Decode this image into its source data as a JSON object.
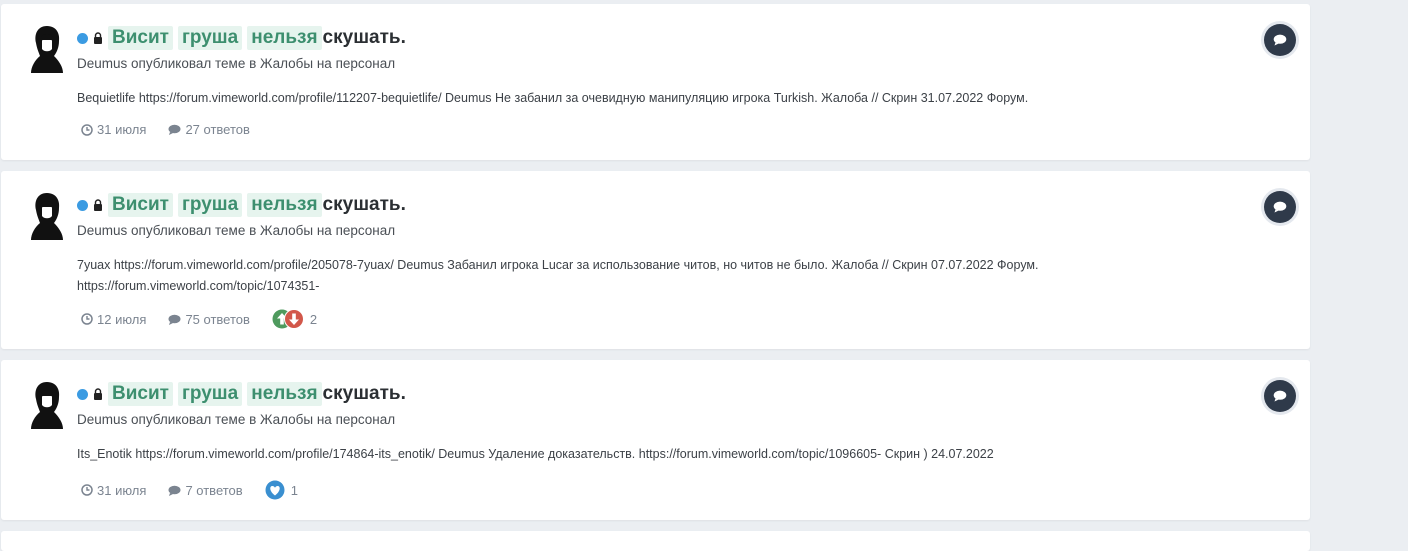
{
  "posts": [
    {
      "title_words": [
        "Висит",
        "груша",
        "нельзя"
      ],
      "title_rest": "скушать.",
      "meta": "Deumus опубликовал теме в Жалобы на персонал",
      "snippet": "Bequietlife https://forum.vimeworld.com/profile/112207-bequietlife/ Deumus Не забанил за очевидную манипуляцию игрока Turkish. Жалоба // Скрин 31.07.2022 Форум.",
      "date": "31 июля",
      "replies": "27 ответов",
      "reaction": null
    },
    {
      "title_words": [
        "Висит",
        "груша",
        "нельзя"
      ],
      "title_rest": "скушать.",
      "meta": "Deumus опубликовал теме в Жалобы на персонал",
      "snippet": "7yuax https://forum.vimeworld.com/profile/205078-7yuax/ Deumus Забанил игрока Lucar за использование читов, но читов не было. Жалоба // Скрин 07.07.2022 Форум. https://forum.vimeworld.com/topic/1074351-",
      "date": "12 июля",
      "replies": "75 ответов",
      "reaction": {
        "icons": [
          "upvote-icon",
          "downvote-icon"
        ],
        "count": "2"
      }
    },
    {
      "title_words": [
        "Висит",
        "груша",
        "нельзя"
      ],
      "title_rest": "скушать.",
      "meta": "Deumus опубликовал теме в Жалобы на персонал",
      "snippet": "Its_Enotik https://forum.vimeworld.com/profile/174864-its_enotik/ Deumus Удаление доказательств. https://forum.vimeworld.com/topic/1096605- Скрин ) 24.07.2022",
      "date": "31 июля",
      "replies": "7 ответов",
      "reaction": {
        "icons": [
          "heart-icon"
        ],
        "count": "1"
      }
    }
  ],
  "colors": {
    "highlight_bg": "#e6f4ee",
    "highlight_text": "#3d8f6f",
    "online_dot": "#3b9be2",
    "chat_button": "#2f3a4a",
    "upvote": "#4f9a5e",
    "downvote": "#d2574a",
    "heart": "#3a8fd0"
  },
  "icons": {
    "status": "online-dot-icon",
    "locked": "lock-icon",
    "date": "clock-icon",
    "replies": "comment-icon",
    "action": "chat-bubble-icon"
  }
}
